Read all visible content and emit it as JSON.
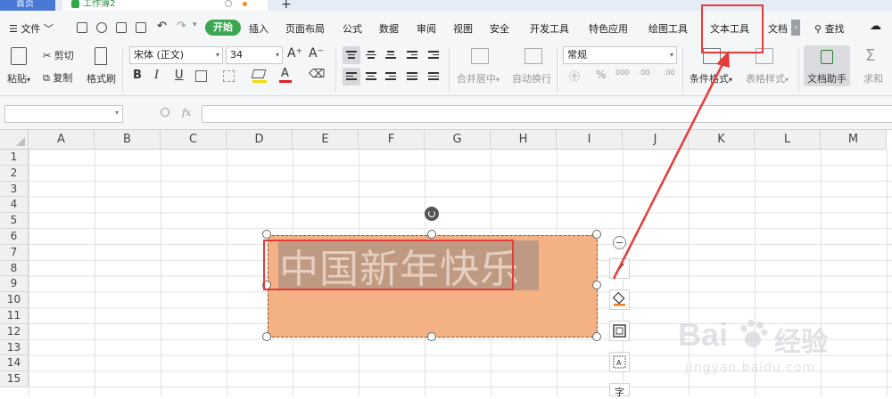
{
  "tabs": {
    "home": "首页",
    "workbook": "工作簿2",
    "add": "+"
  },
  "menu": {
    "file": "文件",
    "items": [
      "插入",
      "页面布局",
      "公式",
      "数据",
      "审阅",
      "视图",
      "安全",
      "开发工具",
      "特色应用",
      "绘图工具",
      "文本工具",
      "文档"
    ],
    "start": "开始",
    "search": "查找",
    "scroll": "›"
  },
  "ribbon": {
    "paste": "粘贴",
    "cut": "剪切",
    "copy": "复制",
    "format_painter": "格式刷",
    "font_name": "宋体 (正文)",
    "font_size": "34",
    "bold": "B",
    "italic": "I",
    "underline": "U",
    "merge_center": "合并居中",
    "wrap_text": "自动换行",
    "number_format": "常规",
    "percent": "%",
    "decimals_inc": ".00",
    "decimals_dec": ".00",
    "thousands": "000",
    "conditional_format": "条件格式",
    "table_style": "表格样式",
    "doc_helper": "文档助手",
    "sum": "求和"
  },
  "formula_bar": {
    "name_value": "",
    "fx": "fx",
    "formula_value": ""
  },
  "grid": {
    "columns": [
      "A",
      "B",
      "C",
      "D",
      "E",
      "F",
      "G",
      "H",
      "I",
      "J",
      "K",
      "L",
      "M"
    ],
    "rows": [
      "1",
      "2",
      "3",
      "4",
      "5",
      "6",
      "7",
      "8",
      "9",
      "10",
      "11",
      "12",
      "13",
      "14",
      "15"
    ]
  },
  "textbox": {
    "text": "中国新年快乐",
    "fill_color": "#f4b183",
    "highlight_color": "#e63b3b"
  },
  "watermark": {
    "brand": "Bai",
    "brand2": "经验",
    "url": "jingyan.baidu.com"
  },
  "colors": {
    "accent_green": "#3aa751",
    "annotation_red": "#e63b3b",
    "tab_blue": "#4a78d6"
  }
}
